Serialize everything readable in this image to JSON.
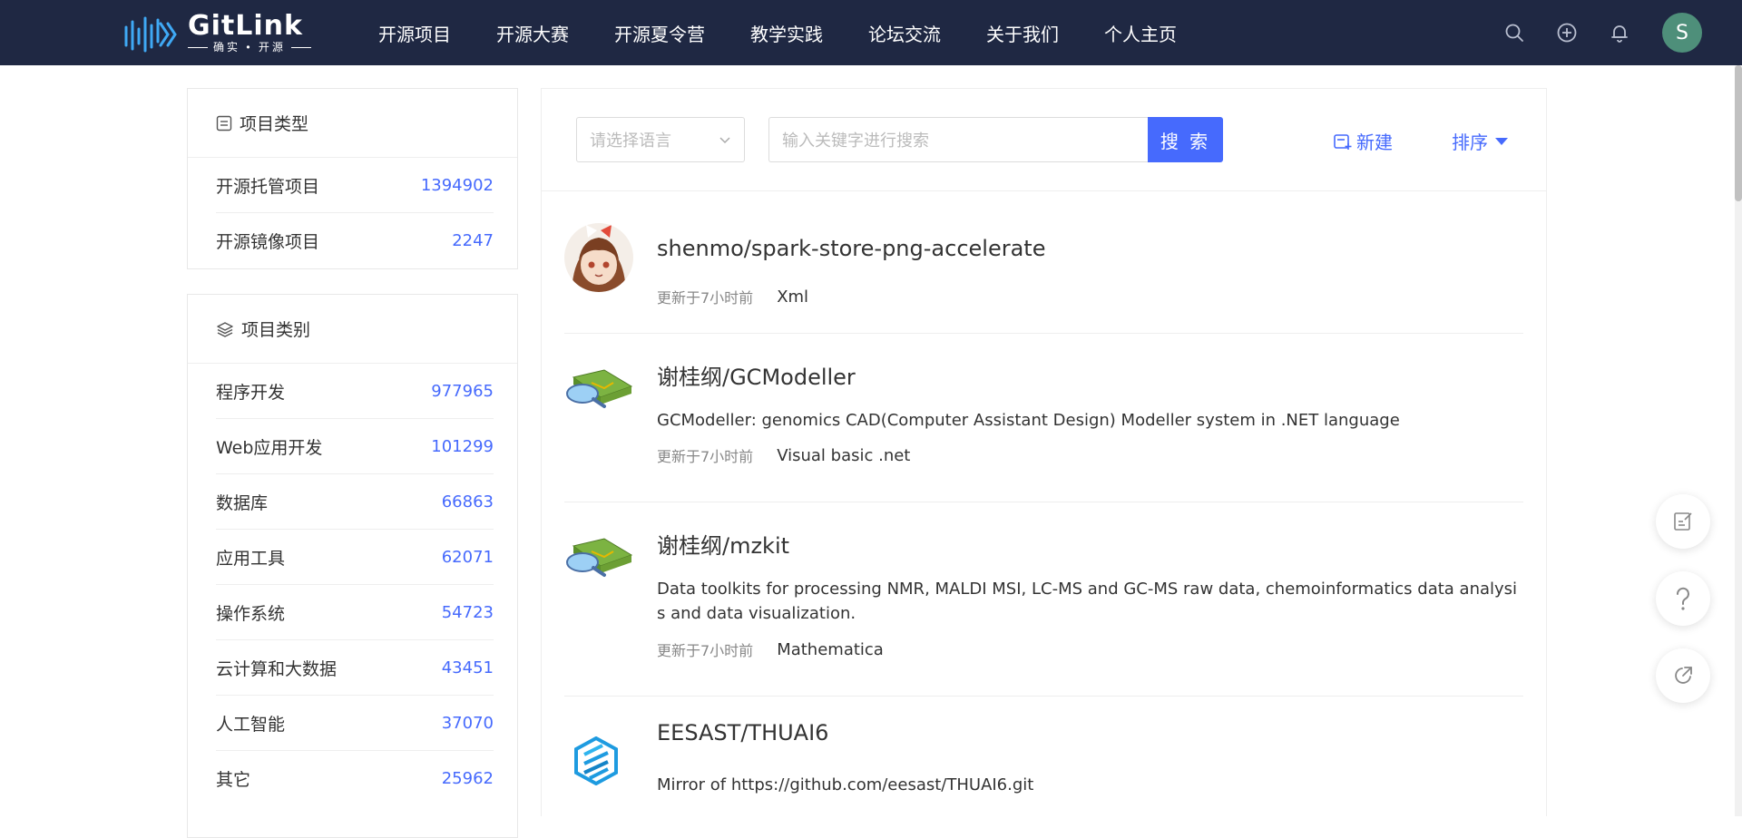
{
  "brand": {
    "name": "GitLink",
    "slogan": "确实 • 开源"
  },
  "nav": {
    "items": [
      {
        "label": "开源项目"
      },
      {
        "label": "开源大赛"
      },
      {
        "label": "开源夏令营"
      },
      {
        "label": "教学实践"
      },
      {
        "label": "论坛交流"
      },
      {
        "label": "关于我们"
      },
      {
        "label": "个人主页"
      }
    ]
  },
  "user": {
    "avatar_initial": "S",
    "avatar_color": "#4e8f7a"
  },
  "project_type": {
    "title": "项目类型",
    "items": [
      {
        "label": "开源托管项目",
        "count": "1394902"
      },
      {
        "label": "开源镜像项目",
        "count": "2247"
      }
    ]
  },
  "project_category": {
    "title": "项目类别",
    "items": [
      {
        "label": "程序开发",
        "count": "977965"
      },
      {
        "label": "Web应用开发",
        "count": "101299"
      },
      {
        "label": "数据库",
        "count": "66863"
      },
      {
        "label": "应用工具",
        "count": "62071"
      },
      {
        "label": "操作系统",
        "count": "54723"
      },
      {
        "label": "云计算和大数据",
        "count": "43451"
      },
      {
        "label": "人工智能",
        "count": "37070"
      },
      {
        "label": "其它",
        "count": "25962"
      }
    ]
  },
  "search": {
    "language_placeholder": "请选择语言",
    "keyword_placeholder": "输入关键字进行搜索",
    "button_label": "搜 索",
    "new_label": "新建",
    "sort_label": "排序"
  },
  "repos": [
    {
      "title": "shenmo/spark-store-png-accelerate",
      "description": "",
      "updated": "更新于7小时前",
      "language": "Xml"
    },
    {
      "title": "谢桂纲/GCModeller",
      "description": "GCModeller: genomics CAD(Computer Assistant Design) Modeller system in .NET language",
      "updated": "更新于7小时前",
      "language": "Visual basic .net"
    },
    {
      "title": "谢桂纲/mzkit",
      "description": "Data toolkits for processing NMR, MALDI MSI, LC-MS and GC-MS raw data, chemoinformatics data analysis and data visualization.",
      "updated": "更新于7小时前",
      "language": "Mathematica"
    },
    {
      "title": "EESAST/THUAI6",
      "description": "Mirror of https://github.com/eesast/THUAI6.git",
      "updated": "",
      "language": ""
    }
  ],
  "colors": {
    "nav_bg": "#1f2843",
    "accent": "#466afd",
    "border": "#eeeeee"
  }
}
